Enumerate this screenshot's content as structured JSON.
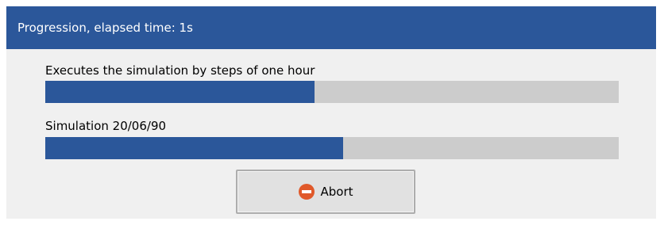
{
  "window": {
    "title": "Progression, elapsed time: 1s"
  },
  "tasks": [
    {
      "label": "Executes the simulation by steps of one hour",
      "progress_fraction": 0.47
    },
    {
      "label": "Simulation 20/06/90",
      "progress_fraction": 0.52
    }
  ],
  "actions": {
    "abort_label": "Abort",
    "abort_icon": "stop-icon"
  },
  "colors": {
    "accent": "#2b579a",
    "track": "#cccccc",
    "abort_icon": "#e0592a"
  }
}
